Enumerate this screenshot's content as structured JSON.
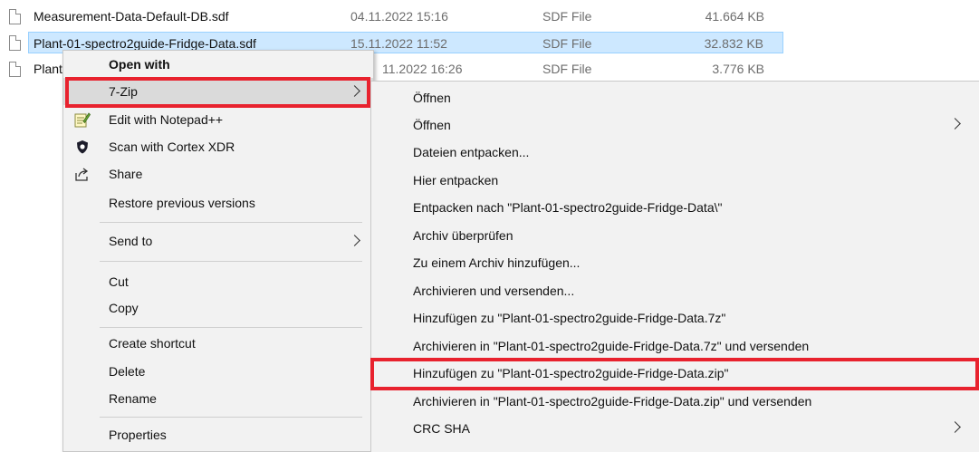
{
  "files": [
    {
      "name": "Measurement-Data-Default-DB.sdf",
      "date": "04.11.2022 15:16",
      "type": "SDF File",
      "size": "41.664 KB"
    },
    {
      "name": "Plant-01-spectro2guide-Fridge-Data.sdf",
      "date": "15.11.2022 11:52",
      "type": "SDF File",
      "size": "32.832 KB"
    },
    {
      "name": "Plant",
      "date": "11.2022 16:26",
      "type": "SDF File",
      "size": "3.776 KB"
    }
  ],
  "context_menu": {
    "open_with": "Open with",
    "seven_zip": "7-Zip",
    "notepad": "Edit with Notepad++",
    "cortex": "Scan with Cortex XDR",
    "share": "Share",
    "restore": "Restore previous versions",
    "send_to": "Send to",
    "cut": "Cut",
    "copy": "Copy",
    "create_shortcut": "Create shortcut",
    "delete": "Delete",
    "rename": "Rename",
    "properties": "Properties"
  },
  "submenu": {
    "items": [
      "Öffnen",
      "Öffnen",
      "Dateien entpacken...",
      "Hier entpacken",
      "Entpacken nach \"Plant-01-spectro2guide-Fridge-Data\\\"",
      "Archiv überprüfen",
      "Zu einem Archiv hinzufügen...",
      "Archivieren und versenden...",
      "Hinzufügen zu \"Plant-01-spectro2guide-Fridge-Data.7z\"",
      "Archivieren in \"Plant-01-spectro2guide-Fridge-Data.7z\" und versenden",
      "Hinzufügen zu \"Plant-01-spectro2guide-Fridge-Data.zip\"",
      "Archivieren in \"Plant-01-spectro2guide-Fridge-Data.zip\" und versenden",
      "CRC SHA"
    ]
  },
  "colors": {
    "highlight_box": "#e8222e",
    "selection": "#cde8ff",
    "menu_bg": "#f2f2f2"
  }
}
